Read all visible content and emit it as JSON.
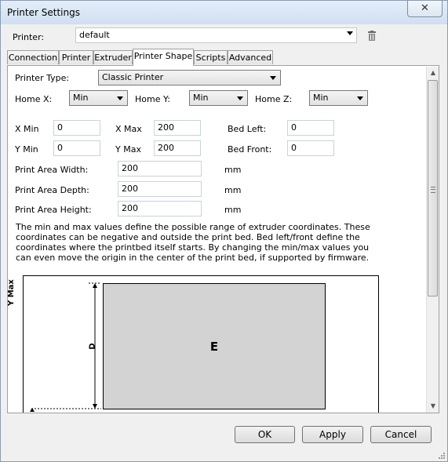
{
  "window": {
    "title": "Printer Settings",
    "close_symbol": "✕"
  },
  "printer": {
    "label": "Printer:",
    "value": "default"
  },
  "tabs": [
    {
      "label": "Connection"
    },
    {
      "label": "Printer"
    },
    {
      "label": "Extruder"
    },
    {
      "label": "Printer Shape",
      "active": true
    },
    {
      "label": "Scripts"
    },
    {
      "label": "Advanced"
    }
  ],
  "shape": {
    "printer_type_label": "Printer Type:",
    "printer_type_value": "Classic Printer",
    "home_x_label": "Home X:",
    "home_x_value": "Min",
    "home_y_label": "Home Y:",
    "home_y_value": "Min",
    "home_z_label": "Home Z:",
    "home_z_value": "Min",
    "x_min_label": "X Min",
    "x_min_value": "0",
    "x_max_label": "X Max",
    "x_max_value": "200",
    "bed_left_label": "Bed Left:",
    "bed_left_value": "0",
    "y_min_label": "Y Min",
    "y_min_value": "0",
    "y_max_label": "Y Max",
    "y_max_value": "200",
    "bed_front_label": "Bed Front:",
    "bed_front_value": "0",
    "width_label": "Print Area Width:",
    "width_value": "200",
    "depth_label": "Print Area Depth:",
    "depth_value": "200",
    "height_label": "Print Area Height:",
    "height_value": "200",
    "unit": "mm",
    "description": "The min and max values define the possible range of extruder coordinates. These coordinates can be negative and outside the print bed. Bed left/front define the coordinates where the printbed itself starts. By changing the min/max values you can even move the origin in the center of the print bed, if supported by firmware."
  },
  "diagram": {
    "y_max_label": "Y Max",
    "depth_letter": "D",
    "bed_letter": "E"
  },
  "buttons": {
    "ok": "OK",
    "apply": "Apply",
    "cancel": "Cancel"
  },
  "colors": {
    "bed_fill": "#d3d3d3",
    "title_bar": "#dce9f7"
  }
}
